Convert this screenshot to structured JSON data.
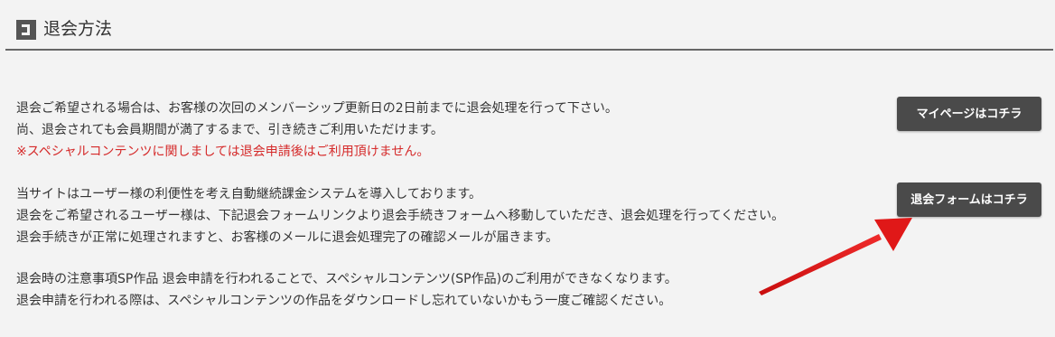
{
  "header": {
    "title": "退会方法",
    "icon": "square-frame-icon"
  },
  "section1": {
    "lines": [
      "退会ご希望される場合は、お客様の次回のメンバーシップ更新日の2日前までに退会処理を行って下さい。",
      "尚、退会されても会員期間が満了するまで、引き続きご利用いただけます。"
    ],
    "notice": "※スペシャルコンテンツに関しましては退会申請後はご利用頂けません。"
  },
  "section2": {
    "lines": [
      "当サイトはユーザー様の利便性を考え自動継続課金システムを導入しております。",
      "退会をご希望されるユーザー様は、下記退会フォームリンクより退会手続きフォームへ移動していただき、退会処理を行ってください。",
      "退会手続きが正常に処理されますと、お客様のメールに退会処理完了の確認メールが届きます。"
    ]
  },
  "section3": {
    "lines": [
      "退会時の注意事項SP作品 退会申請を行われることで、スペシャルコンテンツ(SP作品)のご利用ができなくなります。",
      "退会申請を行われる際は、スペシャルコンテンツの作品をダウンロードし忘れていないかもう一度ご確認ください。"
    ]
  },
  "buttons": {
    "mypage_label": "マイページはコチラ",
    "form_label": "退会フォームはコチラ"
  },
  "annotation": {
    "arrow_color": "#e01818"
  },
  "colors": {
    "background": "#f3f3f3",
    "button": "#4a4a4a",
    "notice": "#d52a2a"
  }
}
